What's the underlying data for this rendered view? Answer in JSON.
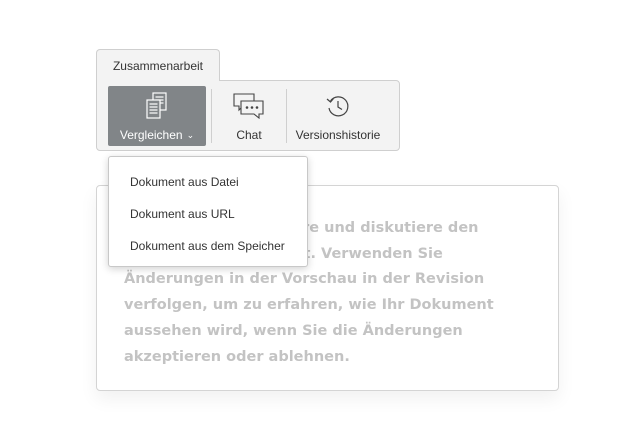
{
  "toolbar": {
    "tab_label": "Zusammenarbeit",
    "buttons": [
      {
        "label": "Vergleichen",
        "icon": "compare-documents-icon",
        "active": true,
        "has_dropdown": true
      },
      {
        "label": "Chat",
        "icon": "chat-icon"
      },
      {
        "label": "Versionshistorie",
        "icon": "version-history-icon"
      }
    ]
  },
  "dropdown": {
    "items": [
      {
        "label": "Dokument aus Datei"
      },
      {
        "label": "Dokument aus URL"
      },
      {
        "label": "Dokument aus dem Speicher"
      }
    ]
  },
  "document": {
    "text": "Kommentiere, redigiere und diskutiere den Inhalt bequem im Chat. Verwenden Sie Änderungen in der Vorschau in der Revision verfolgen, um zu erfahren, wie Ihr Dokument aussehen wird, wenn Sie die Änderungen akzeptieren oder ablehnen."
  },
  "colors": {
    "active_button": "#818588",
    "toolbar_background": "#f3f3f3",
    "document_text": "#c3c3c3"
  }
}
